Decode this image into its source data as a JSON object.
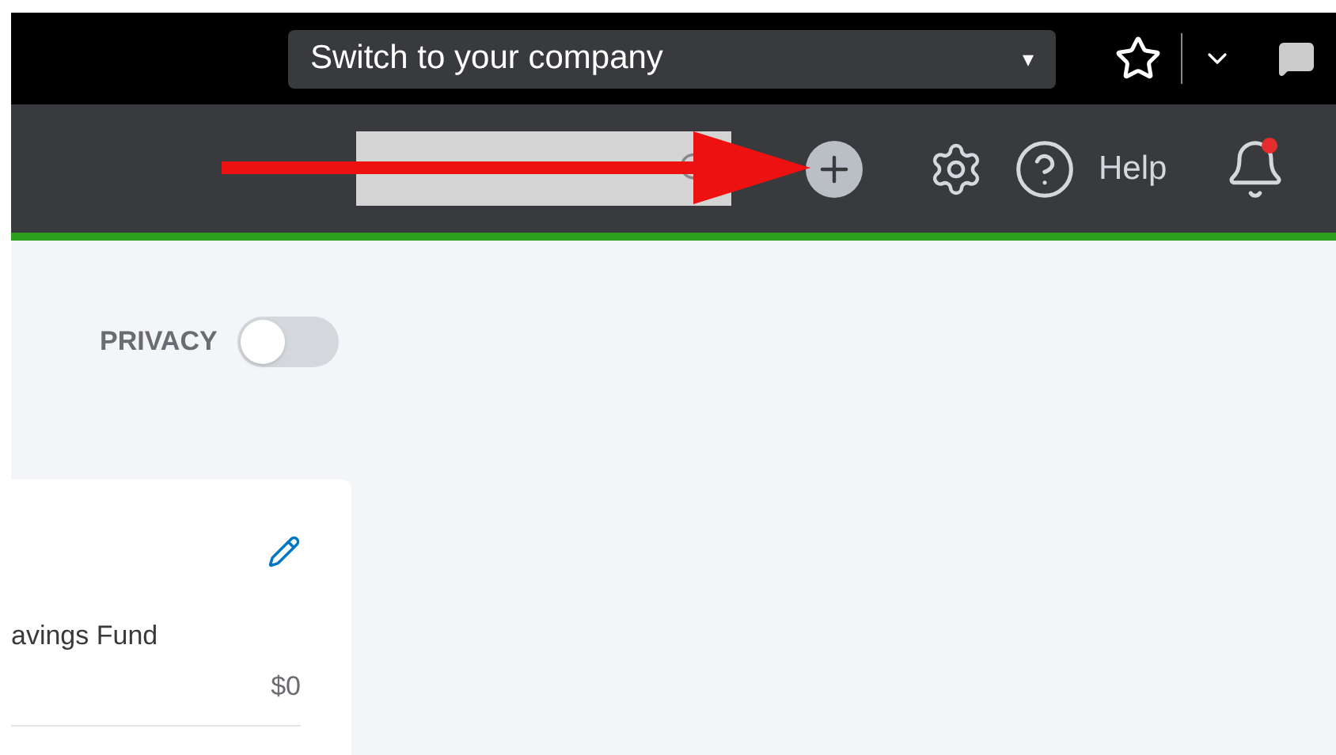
{
  "top_bar": {
    "company_switcher": "Switch to your company",
    "caret": "▾"
  },
  "nav_bar": {
    "help": "Help",
    "notification": true
  },
  "privacy": {
    "label": "PRIVACY",
    "on": false
  },
  "card": {
    "account": "avings Fund",
    "amount": "$0"
  }
}
